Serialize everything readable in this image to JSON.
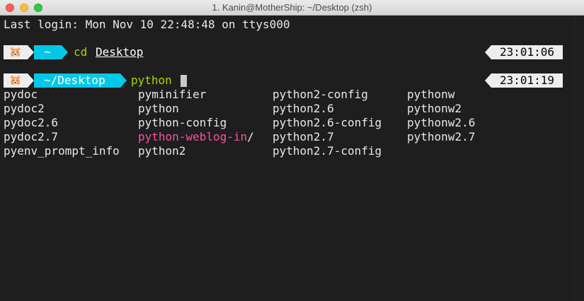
{
  "window": {
    "title": "1. Kanin@MotherShip: ~/Desktop (zsh)"
  },
  "terminal": {
    "last_login": "Last login: Mon Nov 10 22:48:48 on ttys000",
    "prompt_icon": "🐹",
    "prompt1": {
      "dir": "~",
      "command": "cd",
      "argument": "Desktop",
      "time": "23:01:06"
    },
    "prompt2": {
      "dir": "~/Desktop",
      "command": "python",
      "time": "23:01:19"
    },
    "completions": [
      [
        "pydoc",
        "pyminifier",
        "python2-config",
        "pythonw"
      ],
      [
        "pydoc2",
        "python",
        "python2.6",
        "pythonw2"
      ],
      [
        "pydoc2.6",
        "python-config",
        "python2.6-config",
        "pythonw2.6"
      ],
      [
        "pydoc2.7",
        "python-weblog-in",
        "python2.7",
        "pythonw2.7"
      ],
      [
        "pyenv_prompt_info",
        "python2",
        "python2.7-config",
        ""
      ]
    ],
    "dir_suffix": "/",
    "colors": {
      "background": "#1e1e1e",
      "text": "#e8e8e8",
      "command": "#a3d900",
      "dir_segment": "#00c8e6",
      "icon_segment": "#ededed",
      "highlight": "#ff4fa3"
    }
  }
}
